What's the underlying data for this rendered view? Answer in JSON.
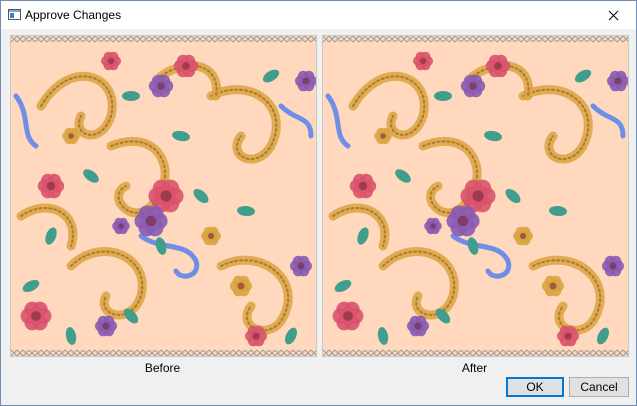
{
  "window": {
    "title": "Approve Changes"
  },
  "icons": {
    "app": "app-window-icon",
    "close": "close-icon"
  },
  "panels": {
    "before": {
      "caption": "Before",
      "content": "floral cross-stitch pattern preview"
    },
    "after": {
      "caption": "After",
      "content": "floral cross-stitch pattern preview"
    }
  },
  "buttons": {
    "ok": "OK",
    "cancel": "Cancel"
  },
  "colors": {
    "background": "#ffd8bd",
    "rose": "#d9536b",
    "violet": "#8a5bb0",
    "teal": "#3f9e8c",
    "gold": "#d8a440",
    "blue_ribbon": "#6f8ee8"
  }
}
